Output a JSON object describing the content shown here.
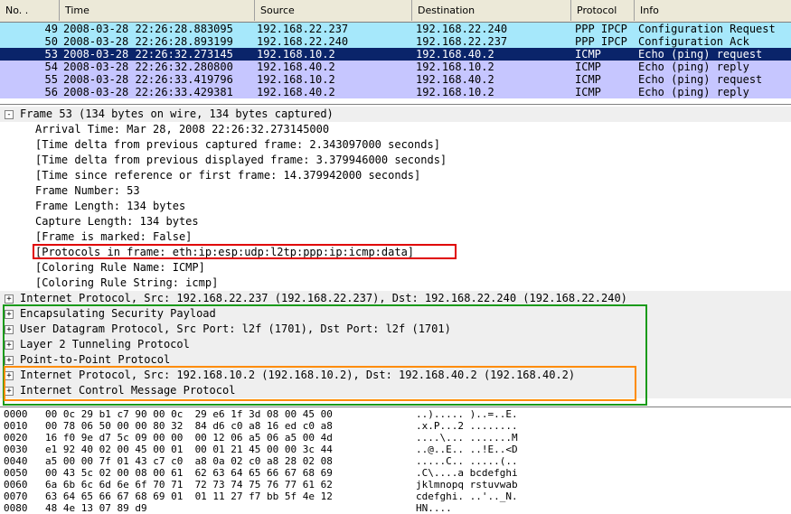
{
  "packet_list": {
    "columns": [
      "No. .",
      "Time",
      "Source",
      "Destination",
      "Protocol",
      "Info"
    ],
    "rows": [
      {
        "no": "49",
        "time": "2008-03-28 22:26:28.883095",
        "src": "192.168.22.237",
        "dst": "192.168.22.240",
        "proto": "PPP IPCP",
        "info": "Configuration Request",
        "bg": "#a6e8fb",
        "fg": "#000000"
      },
      {
        "no": "50",
        "time": "2008-03-28 22:26:28.893199",
        "src": "192.168.22.240",
        "dst": "192.168.22.237",
        "proto": "PPP IPCP",
        "info": "Configuration Ack",
        "bg": "#a6e8fb",
        "fg": "#000000"
      },
      {
        "no": "53",
        "time": "2008-03-28 22:26:32.273145",
        "src": "192.168.10.2",
        "dst": "192.168.40.2",
        "proto": "ICMP",
        "info": "Echo (ping) request",
        "bg": "#0a246a",
        "fg": "#ffffff"
      },
      {
        "no": "54",
        "time": "2008-03-28 22:26:32.280800",
        "src": "192.168.40.2",
        "dst": "192.168.10.2",
        "proto": "ICMP",
        "info": "Echo (ping) reply",
        "bg": "#c6c6ff",
        "fg": "#000000"
      },
      {
        "no": "55",
        "time": "2008-03-28 22:26:33.419796",
        "src": "192.168.10.2",
        "dst": "192.168.40.2",
        "proto": "ICMP",
        "info": "Echo (ping) request",
        "bg": "#c6c6ff",
        "fg": "#000000"
      },
      {
        "no": "56",
        "time": "2008-03-28 22:26:33.429381",
        "src": "192.168.40.2",
        "dst": "192.168.10.2",
        "proto": "ICMP",
        "info": "Echo (ping) reply",
        "bg": "#c6c6ff",
        "fg": "#000000"
      }
    ]
  },
  "details": {
    "lines": [
      {
        "text": "Frame 53 (134 bytes on wire, 134 bytes captured)",
        "level": 0,
        "expander": "-"
      },
      {
        "text": "Arrival Time: Mar 28, 2008 22:26:32.273145000",
        "level": 1
      },
      {
        "text": "[Time delta from previous captured frame: 2.343097000 seconds]",
        "level": 1
      },
      {
        "text": "[Time delta from previous displayed frame: 3.379946000 seconds]",
        "level": 1
      },
      {
        "text": "[Time since reference or first frame: 14.379942000 seconds]",
        "level": 1
      },
      {
        "text": "Frame Number: 53",
        "level": 1
      },
      {
        "text": "Frame Length: 134 bytes",
        "level": 1
      },
      {
        "text": "Capture Length: 134 bytes",
        "level": 1
      },
      {
        "text": "[Frame is marked: False]",
        "level": 1
      },
      {
        "text": "[Protocols in frame: eth:ip:esp:udp:l2tp:ppp:ip:icmp:data]",
        "level": 1
      },
      {
        "text": "[Coloring Rule Name: ICMP]",
        "level": 1
      },
      {
        "text": "[Coloring Rule String: icmp]",
        "level": 1
      },
      {
        "text": "Internet Protocol, Src: 192.168.22.237 (192.168.22.237), Dst: 192.168.22.240 (192.168.22.240)",
        "level": 0,
        "expander": "+"
      },
      {
        "text": "Encapsulating Security Payload",
        "level": 0,
        "expander": "+"
      },
      {
        "text": "User Datagram Protocol, Src Port: l2f (1701), Dst Port: l2f (1701)",
        "level": 0,
        "expander": "+"
      },
      {
        "text": "Layer 2 Tunneling Protocol",
        "level": 0,
        "expander": "+"
      },
      {
        "text": "Point-to-Point Protocol",
        "level": 0,
        "expander": "+"
      },
      {
        "text": "Internet Protocol, Src: 192.168.10.2 (192.168.10.2), Dst: 192.168.40.2 (192.168.40.2)",
        "level": 0,
        "expander": "+"
      },
      {
        "text": "Internet Control Message Protocol",
        "level": 0,
        "expander": "+"
      }
    ]
  },
  "hex_dump": {
    "lines": [
      {
        "offset": "0000",
        "bytes": "00 0c 29 b1 c7 90 00 0c  29 e6 1f 3d 08 00 45 00",
        "ascii": "..)..... )..=..E."
      },
      {
        "offset": "0010",
        "bytes": "00 78 06 50 00 00 80 32  84 d6 c0 a8 16 ed c0 a8",
        "ascii": ".x.P...2 ........"
      },
      {
        "offset": "0020",
        "bytes": "16 f0 9e d7 5c 09 00 00  00 12 06 a5 06 a5 00 4d",
        "ascii": "....\\... .......M"
      },
      {
        "offset": "0030",
        "bytes": "e1 92 40 02 00 45 00 01  00 01 21 45 00 00 3c 44",
        "ascii": "..@..E.. ..!E..<D"
      },
      {
        "offset": "0040",
        "bytes": "a5 00 00 7f 01 43 c7 c0  a8 0a 02 c0 a8 28 02 08",
        "ascii": ".....C.. .....(.."
      },
      {
        "offset": "0050",
        "bytes": "00 43 5c 02 00 08 00 61  62 63 64 65 66 67 68 69",
        "ascii": ".C\\....a bcdefghi"
      },
      {
        "offset": "0060",
        "bytes": "6a 6b 6c 6d 6e 6f 70 71  72 73 74 75 76 77 61 62",
        "ascii": "jklmnopq rstuvwab"
      },
      {
        "offset": "0070",
        "bytes": "63 64 65 66 67 68 69 01  01 11 27 f7 bb 5f 4e 12",
        "ascii": "cdefghi. ..'.._N."
      },
      {
        "offset": "0080",
        "bytes": "48 4e 13 07 89 d9",
        "ascii": "HN...."
      }
    ]
  }
}
